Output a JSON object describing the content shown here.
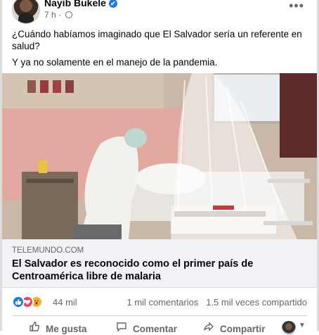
{
  "post": {
    "author": "Nayib Bukele",
    "time": "7 h",
    "time_separator": "·",
    "verified_mark": "✔",
    "more_options": "•••",
    "text_line1": "¿Cuándo habíamos imaginado que El Salvador sería un referente en salud?",
    "text_line2": "Y ya no solamente en el manejo de la pandemia."
  },
  "link_preview": {
    "domain": "TELEMUNDO.COM",
    "title": "El Salvador es reconocido como el primer país de Centroamérica libre de malaria"
  },
  "reactions": {
    "count": "44 mil",
    "comments": "1 mil comentarios",
    "shares": "1.5 mil veces compartido",
    "types": [
      "like",
      "love",
      "wow"
    ]
  },
  "actions": {
    "like": "Me gusta",
    "comment": "Comentar",
    "share": "Compartir"
  },
  "icons": {
    "like": "thumbs-up-icon",
    "comment": "comment-icon",
    "share": "share-icon",
    "privacy": "globe-icon"
  },
  "colors": {
    "brand_blue": "#1877f2",
    "love_red": "#f33e58",
    "wow_yellow": "#f7b125",
    "secondary_text": "#65676b",
    "link_box_bg": "#f0f2f5"
  }
}
